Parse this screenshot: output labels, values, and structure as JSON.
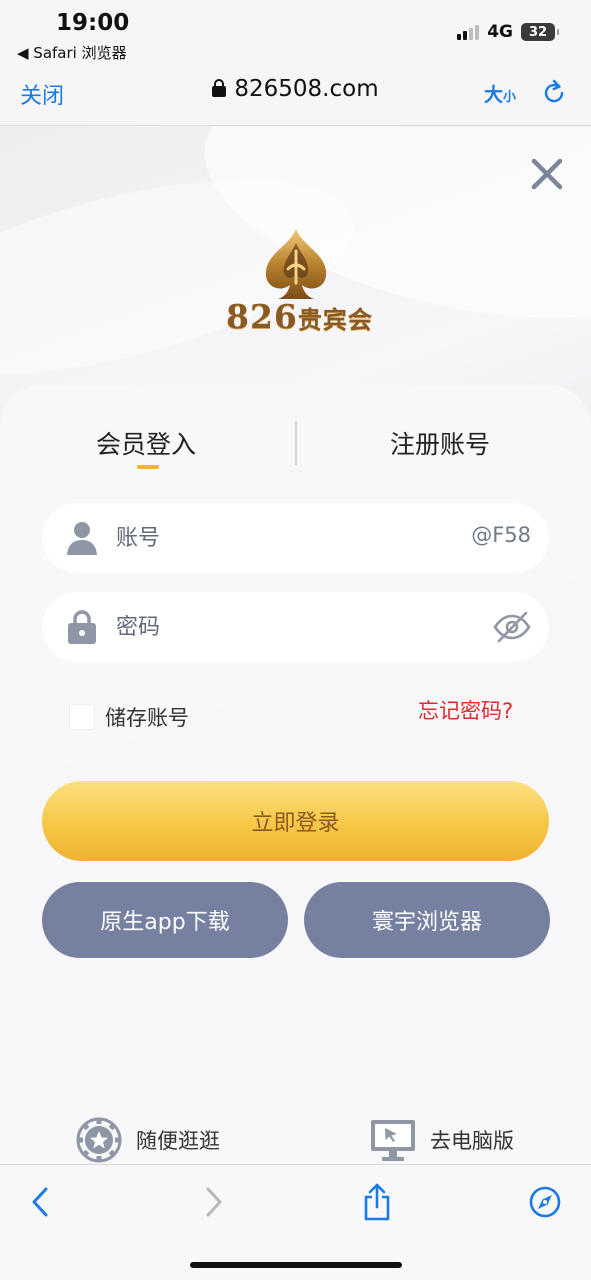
{
  "status_bar": {
    "time": "19:00",
    "back_app": "◀ Safari 浏览器",
    "network": "4G",
    "battery": "32"
  },
  "browser": {
    "close_label": "关闭",
    "url": "826508.com",
    "text_size_big": "大",
    "text_size_small": "小"
  },
  "logo": {
    "number": "826",
    "name": "贵宾会"
  },
  "tabs": {
    "login": "会员登入",
    "register": "注册账号"
  },
  "form": {
    "account_placeholder": "账号",
    "account_suffix": "@F58",
    "password_placeholder": "密码",
    "remember_label": "储存账号",
    "forgot_label": "忘记密码?"
  },
  "buttons": {
    "login": "立即登录",
    "app_download": "原生app下载",
    "browser": "寰宇浏览器"
  },
  "bottom_links": {
    "browse": "随便逛逛",
    "desktop": "去电脑版"
  },
  "colors": {
    "accent_blue": "#1a7ae8",
    "login_gold": "#f7c744",
    "pill_gray": "#7680a0",
    "forgot_red": "#e02b2b"
  }
}
